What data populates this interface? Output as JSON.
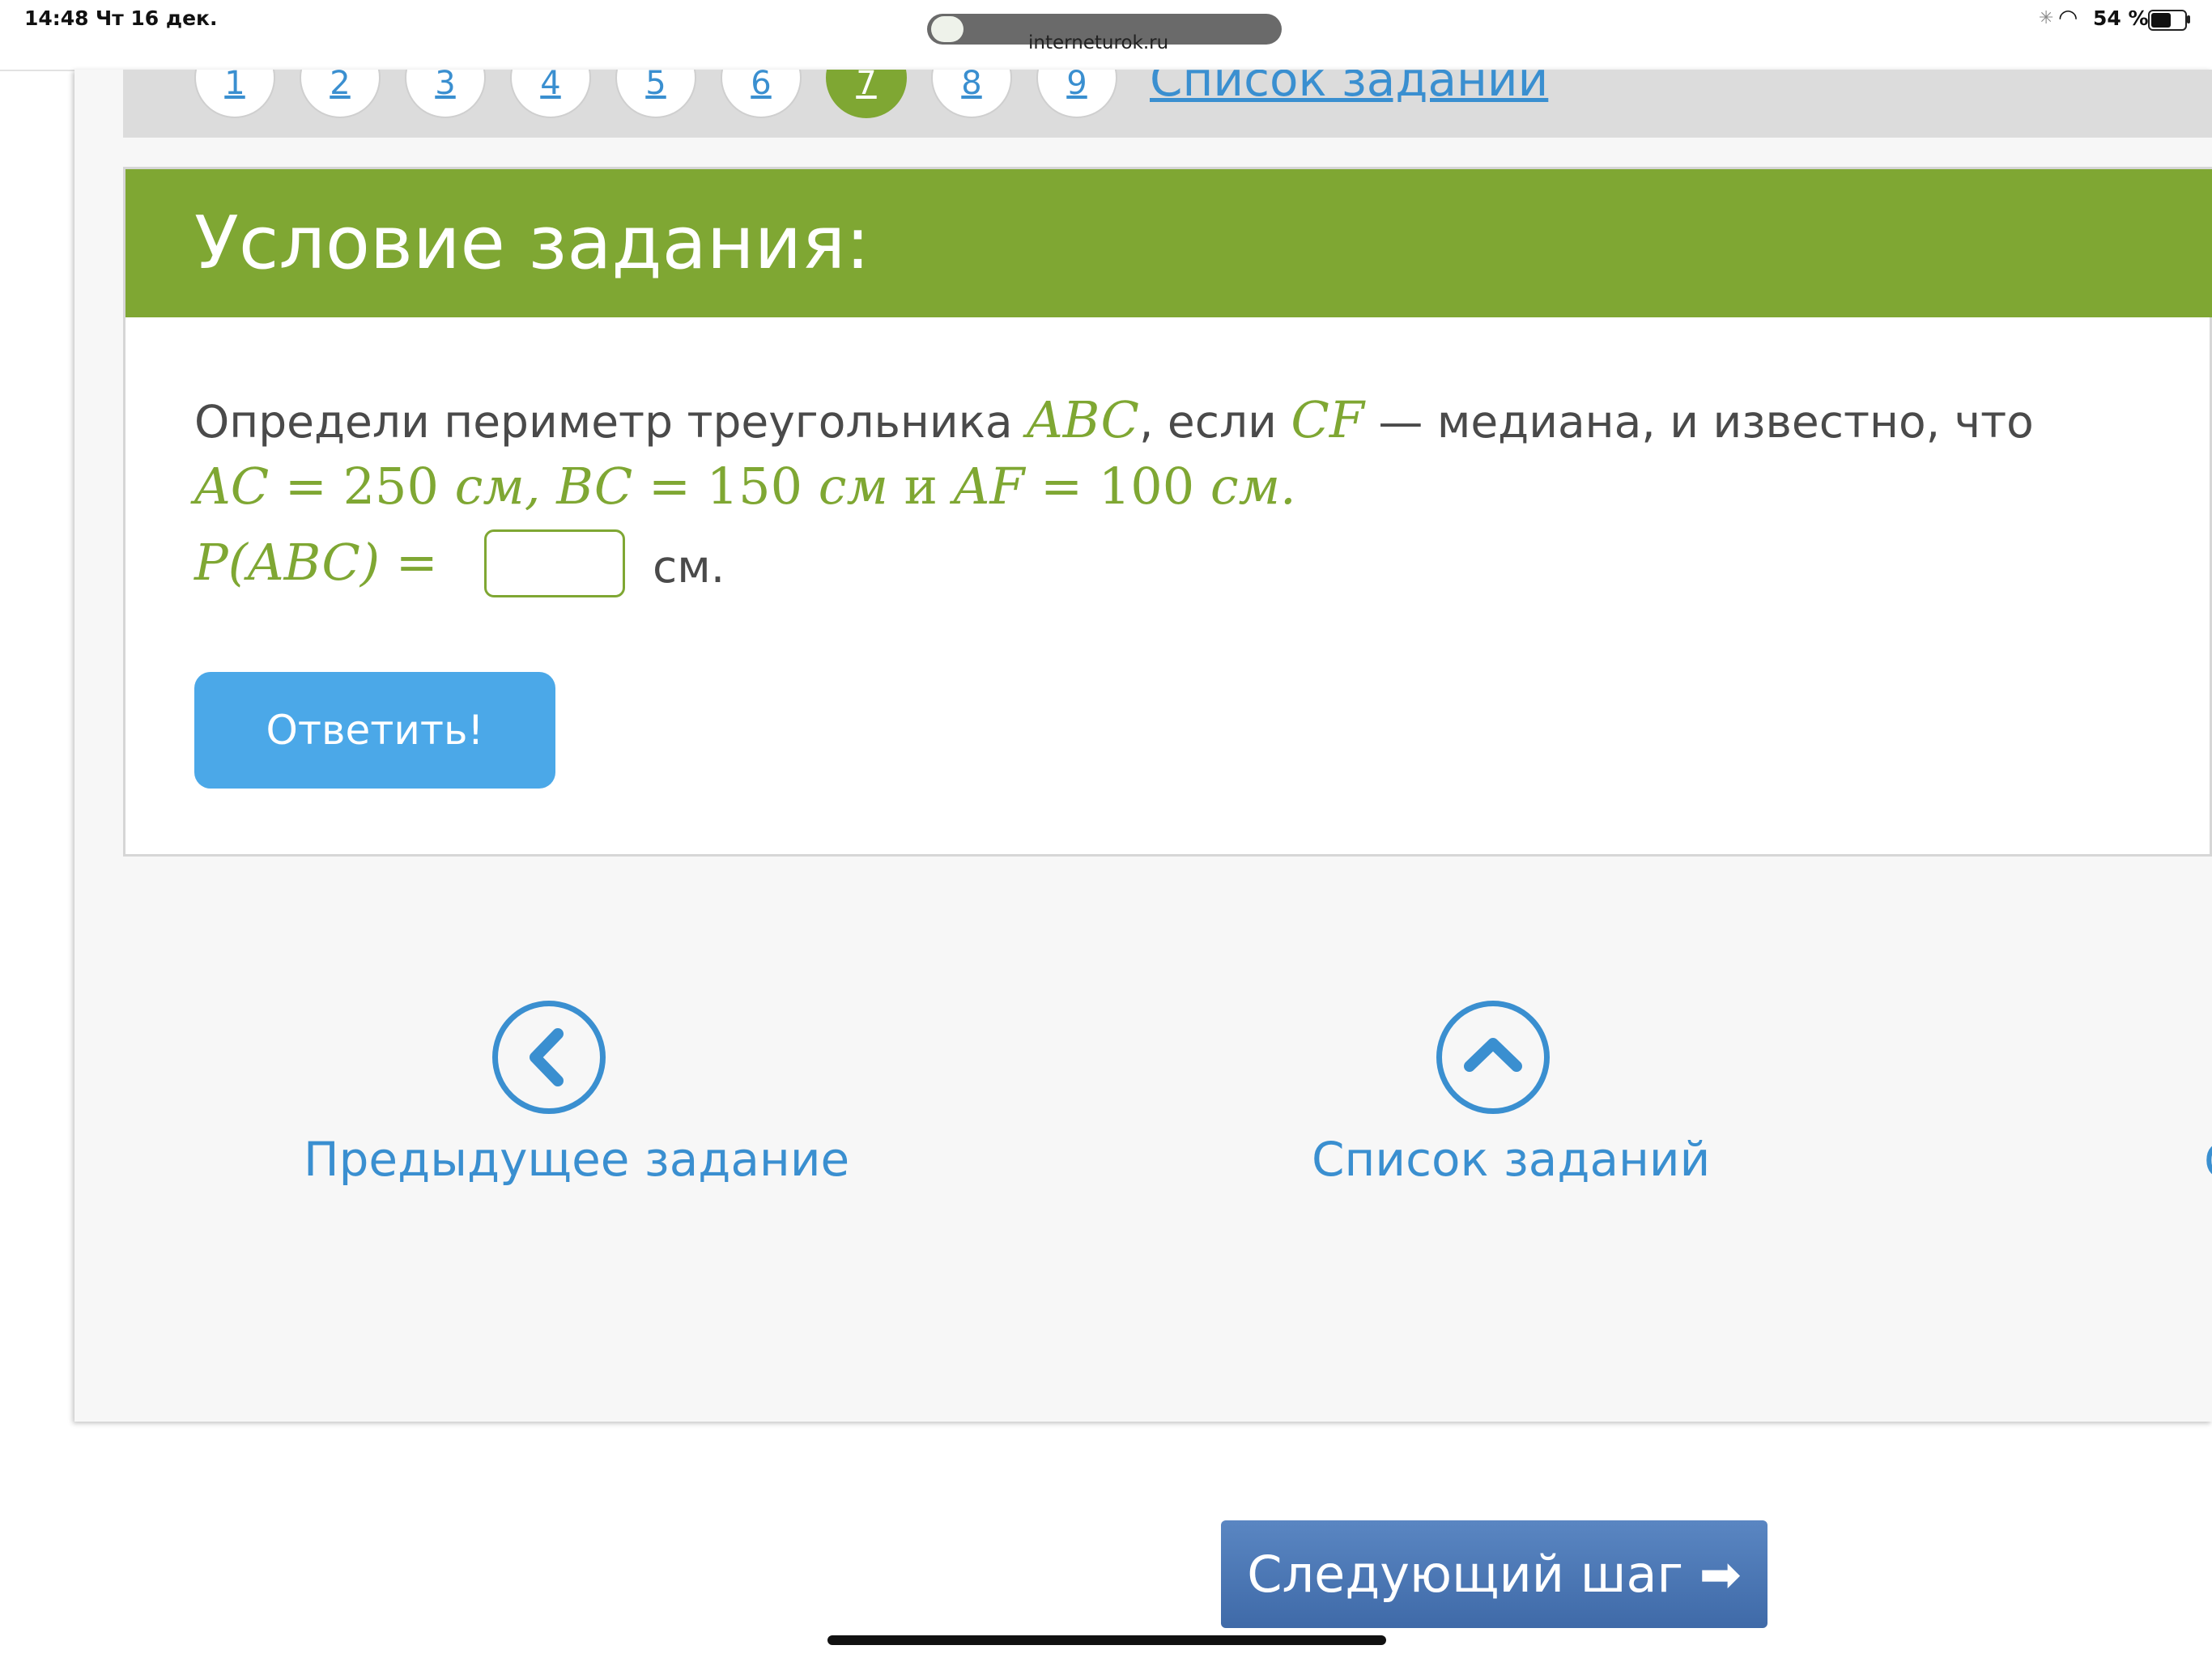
{
  "status_bar": {
    "time": "14:48",
    "date": "Чт 16 дек.",
    "battery": "54 %",
    "url": "interneturok.ru"
  },
  "pager": {
    "items": [
      "1",
      "2",
      "3",
      "4",
      "5",
      "6",
      "7",
      "8",
      "9"
    ],
    "active": "7",
    "list_link": "Список заданий"
  },
  "task": {
    "header": "Условие задания:",
    "line1_text_a": "Определи периметр треугольника ",
    "line1_math_a": "ABC",
    "line1_text_b": ", если ",
    "line1_math_b": "CF",
    "line1_text_c": " — медиана, и известно, что",
    "line2_ac": "AC",
    "line2_ac_val": " = 250 ",
    "line2_unit1": "см, ",
    "line2_bc": "BC",
    "line2_bc_val": " = 150 ",
    "line2_unit2": "см",
    "line2_and": " и ",
    "line2_af": "AF",
    "line2_af_val": " = 100 ",
    "line2_unit3": "см.",
    "line3_expr": "P(ABC) =",
    "answer_value": "",
    "unit": "см.",
    "submit_label": "Ответить!"
  },
  "nav": {
    "prev_label": "Предыдущее задание",
    "list_label": "Список заданий",
    "next_hint": "С"
  },
  "next_step_label": "Следующий шаг ➡"
}
